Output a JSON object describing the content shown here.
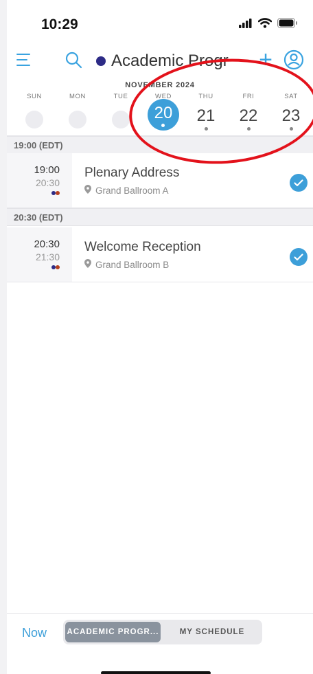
{
  "status_bar": {
    "time": "10:29",
    "icons": [
      "signal-icon",
      "wifi-icon",
      "battery-icon"
    ]
  },
  "header": {
    "menu_icon": "hamburger-icon",
    "search_icon": "search-icon",
    "title": "Academic Progr",
    "title_dot_color": "#2d2b86",
    "add_label": "+",
    "profile_icon": "profile-icon",
    "accent_color": "#3aa3e0"
  },
  "calendar": {
    "month": "NOVEMBER 2024",
    "days": [
      {
        "name": "SUN",
        "num": "",
        "state": "empty"
      },
      {
        "name": "MON",
        "num": "",
        "state": "empty"
      },
      {
        "name": "TUE",
        "num": "",
        "state": "empty"
      },
      {
        "name": "WED",
        "num": "20",
        "state": "selected"
      },
      {
        "name": "THU",
        "num": "21",
        "state": "normal"
      },
      {
        "name": "FRI",
        "num": "22",
        "state": "normal"
      },
      {
        "name": "SAT",
        "num": "23",
        "state": "normal"
      }
    ]
  },
  "schedule": {
    "sections": [
      {
        "label": "19:00 (EDT)",
        "events": [
          {
            "start": "19:00",
            "end": "20:30",
            "title": "Plenary Address",
            "location": "Grand Ballroom A",
            "tag_colors": [
              "#2d2b86",
              "#b5401f"
            ],
            "checked": true
          }
        ]
      },
      {
        "label": "20:30 (EDT)",
        "events": [
          {
            "start": "20:30",
            "end": "21:30",
            "title": "Welcome Reception",
            "location": "Grand Ballroom B",
            "tag_colors": [
              "#2d2b86",
              "#b5401f"
            ],
            "checked": true
          }
        ]
      }
    ]
  },
  "bottom_bar": {
    "now_label": "Now",
    "tabs": [
      "ACADEMIC PROGR...",
      "MY SCHEDULE"
    ],
    "active_tab": 0
  },
  "annotation": {
    "highlight_color": "#e3121b"
  }
}
